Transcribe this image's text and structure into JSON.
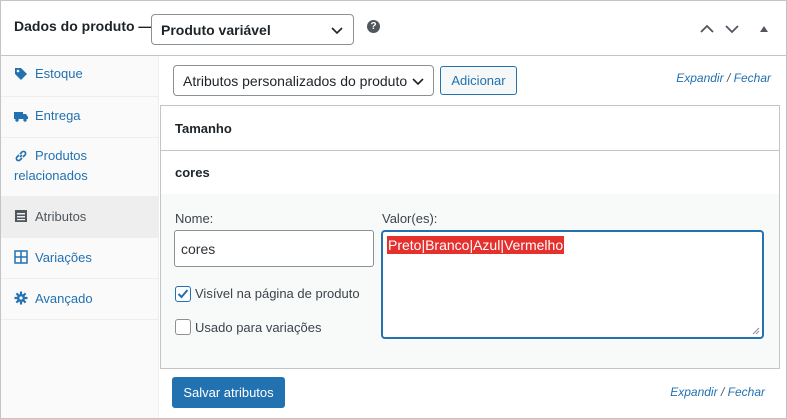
{
  "header": {
    "title": "Dados do produto —",
    "product_type": "Produto variável",
    "help_icon": "question-circle-icon",
    "controls": [
      "chevron-up-icon",
      "chevron-down-icon",
      "collapse-triangle-icon"
    ]
  },
  "sidebar": {
    "items": [
      {
        "label": "Estoque",
        "icon": "tag-icon"
      },
      {
        "label": "Entrega",
        "icon": "truck-icon"
      },
      {
        "label": "Produtos relacionados",
        "icon": "link-icon"
      },
      {
        "label": "Atributos",
        "icon": "list-view-icon"
      },
      {
        "label": "Variações",
        "icon": "grid-icon"
      },
      {
        "label": "Avançado",
        "icon": "gear-icon"
      }
    ],
    "active_index": 3
  },
  "main": {
    "attribute_select": "Atributos personalizados do produto",
    "add_button": "Adicionar",
    "expand_label": "Expandir",
    "expand_sep": "/",
    "close_label": "Fechar",
    "attributes": [
      {
        "title": "Tamanho"
      },
      {
        "title": "cores"
      }
    ],
    "form": {
      "name_label": "Nome:",
      "name_value": "cores",
      "values_label": "Valor(es):",
      "values_value": "Preto|Branco|Azul|Vermelho",
      "visible_label": "Visível na página de produto",
      "visible_checked": true,
      "variations_label": "Usado para variações",
      "variations_checked": false
    },
    "save_button": "Salvar atributos"
  },
  "colors": {
    "accent": "#2271b1",
    "highlight": "#e5312e",
    "border": "#c3c4c7"
  }
}
